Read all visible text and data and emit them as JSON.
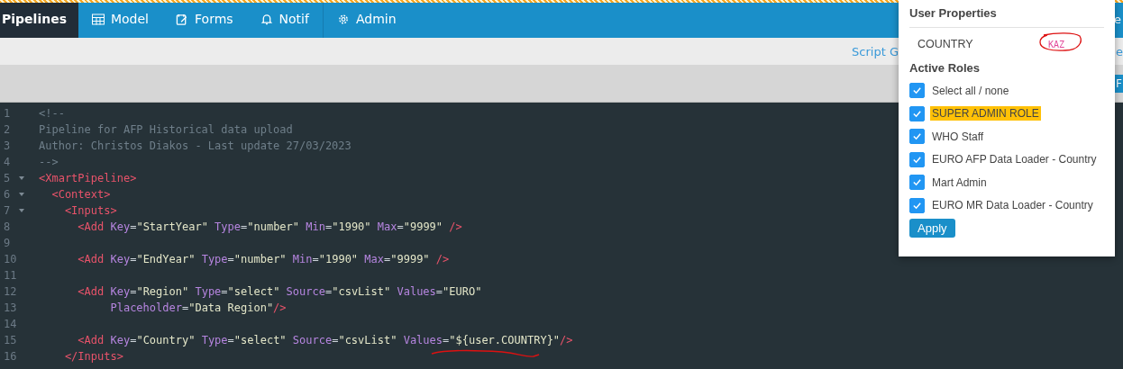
{
  "nav": {
    "items": [
      {
        "label": "Pipelines",
        "kind": "plain",
        "selected": true
      },
      {
        "label": "Model",
        "kind": "table",
        "selected": false
      },
      {
        "label": "Forms",
        "kind": "edit",
        "selected": false
      },
      {
        "label": "Notif",
        "kind": "bell",
        "selected": false
      },
      {
        "label": "Admin",
        "kind": "gear",
        "selected": false
      }
    ],
    "right_fragment": "e"
  },
  "toolbar": {
    "links": [
      "Script G",
      "e"
    ]
  },
  "toolbar2": {
    "button": "F"
  },
  "editor": {
    "lines": [
      {
        "number": "1",
        "foldable": false,
        "tokens": [
          {
            "kind": "comment",
            "t": "<!--"
          }
        ]
      },
      {
        "number": "2",
        "foldable": false,
        "tokens": [
          {
            "kind": "comment",
            "t": "Pipeline for AFP Historical data upload"
          }
        ]
      },
      {
        "number": "3",
        "foldable": false,
        "tokens": [
          {
            "kind": "comment",
            "t": "Author: Christos Diakos - Last update 27/03/2023"
          }
        ]
      },
      {
        "number": "4",
        "foldable": false,
        "tokens": [
          {
            "kind": "comment",
            "t": "-->"
          }
        ]
      },
      {
        "number": "5",
        "foldable": true,
        "tokens": [
          {
            "kind": "tag",
            "t": "<XmartPipeline>"
          }
        ]
      },
      {
        "number": "6",
        "foldable": true,
        "tokens": [
          {
            "kind": "tag",
            "t": "  <Context>"
          }
        ]
      },
      {
        "number": "7",
        "foldable": true,
        "tokens": [
          {
            "kind": "tag",
            "t": "    <Inputs>"
          }
        ]
      },
      {
        "number": "8",
        "foldable": false,
        "tokens": [
          {
            "kind": "tag",
            "t": "      <Add "
          },
          {
            "kind": "attr",
            "t": "Key"
          },
          {
            "kind": "eq",
            "t": "="
          },
          {
            "kind": "str",
            "t": "\"StartYear\" "
          },
          {
            "kind": "attr",
            "t": "Type"
          },
          {
            "kind": "eq",
            "t": "="
          },
          {
            "kind": "str",
            "t": "\"number\" "
          },
          {
            "kind": "attr",
            "t": "Min"
          },
          {
            "kind": "eq",
            "t": "="
          },
          {
            "kind": "str",
            "t": "\"1990\" "
          },
          {
            "kind": "attr",
            "t": "Max"
          },
          {
            "kind": "eq",
            "t": "="
          },
          {
            "kind": "str",
            "t": "\"9999\" "
          },
          {
            "kind": "tag",
            "t": "/>"
          }
        ]
      },
      {
        "number": "9",
        "foldable": false
      },
      {
        "number": "10",
        "foldable": false,
        "tokens": [
          {
            "kind": "tag",
            "t": "      <Add "
          },
          {
            "kind": "attr",
            "t": "Key"
          },
          {
            "kind": "eq",
            "t": "="
          },
          {
            "kind": "str",
            "t": "\"EndYear\" "
          },
          {
            "kind": "attr",
            "t": "Type"
          },
          {
            "kind": "eq",
            "t": "="
          },
          {
            "kind": "str",
            "t": "\"number\" "
          },
          {
            "kind": "attr",
            "t": "Min"
          },
          {
            "kind": "eq",
            "t": "="
          },
          {
            "kind": "str",
            "t": "\"1990\" "
          },
          {
            "kind": "attr",
            "t": "Max"
          },
          {
            "kind": "eq",
            "t": "="
          },
          {
            "kind": "str",
            "t": "\"9999\" "
          },
          {
            "kind": "tag",
            "t": "/>"
          }
        ]
      },
      {
        "number": "11",
        "foldable": false
      },
      {
        "number": "12",
        "foldable": false,
        "tokens": [
          {
            "kind": "tag",
            "t": "      <Add "
          },
          {
            "kind": "attr",
            "t": "Key"
          },
          {
            "kind": "eq",
            "t": "="
          },
          {
            "kind": "str",
            "t": "\"Region\" "
          },
          {
            "kind": "attr",
            "t": "Type"
          },
          {
            "kind": "eq",
            "t": "="
          },
          {
            "kind": "str",
            "t": "\"select\" "
          },
          {
            "kind": "attr",
            "t": "Source"
          },
          {
            "kind": "eq",
            "t": "="
          },
          {
            "kind": "str",
            "t": "\"csvList\" "
          },
          {
            "kind": "attr",
            "t": "Values"
          },
          {
            "kind": "eq",
            "t": "="
          },
          {
            "kind": "str",
            "t": "\"EURO\""
          }
        ]
      },
      {
        "number": "13",
        "foldable": false,
        "tokens": [
          {
            "kind": "attr",
            "t": "           Placeholder"
          },
          {
            "kind": "eq",
            "t": "="
          },
          {
            "kind": "str",
            "t": "\"Data Region\""
          },
          {
            "kind": "tag",
            "t": "/>"
          }
        ]
      },
      {
        "number": "14",
        "foldable": false
      },
      {
        "number": "15",
        "foldable": false,
        "tokens": [
          {
            "kind": "tag",
            "t": "      <Add "
          },
          {
            "kind": "attr",
            "t": "Key"
          },
          {
            "kind": "eq",
            "t": "="
          },
          {
            "kind": "str",
            "t": "\"Country\" "
          },
          {
            "kind": "attr",
            "t": "Type"
          },
          {
            "kind": "eq",
            "t": "="
          },
          {
            "kind": "str",
            "t": "\"select\" "
          },
          {
            "kind": "attr",
            "t": "Source"
          },
          {
            "kind": "eq",
            "t": "="
          },
          {
            "kind": "str",
            "t": "\"csvList\" "
          },
          {
            "kind": "attr",
            "t": "Values"
          },
          {
            "kind": "eq",
            "t": "="
          },
          {
            "kind": "str",
            "t": "\"${user.COUNTRY}\""
          },
          {
            "kind": "tag",
            "t": "/>"
          }
        ]
      },
      {
        "number": "16",
        "foldable": false,
        "tokens": [
          {
            "kind": "tag",
            "t": "    </Inputs>"
          }
        ]
      }
    ]
  },
  "popup": {
    "title": "User Properties",
    "properties": [
      {
        "name": "COUNTRY",
        "value": "KAZ"
      }
    ],
    "roles_title": "Active Roles",
    "roles": [
      {
        "label": "Select all / none",
        "checked": true,
        "highlighted": false
      },
      {
        "label": "SUPER ADMIN ROLE",
        "checked": true,
        "highlighted": true
      },
      {
        "label": "WHO Staff",
        "checked": true,
        "highlighted": false
      },
      {
        "label": "EURO AFP Data Loader - Country",
        "checked": true,
        "highlighted": false
      },
      {
        "label": "Mart Admin",
        "checked": true,
        "highlighted": false
      },
      {
        "label": "EURO MR Data Loader - Country",
        "checked": true,
        "highlighted": false
      }
    ],
    "apply": "Apply"
  }
}
